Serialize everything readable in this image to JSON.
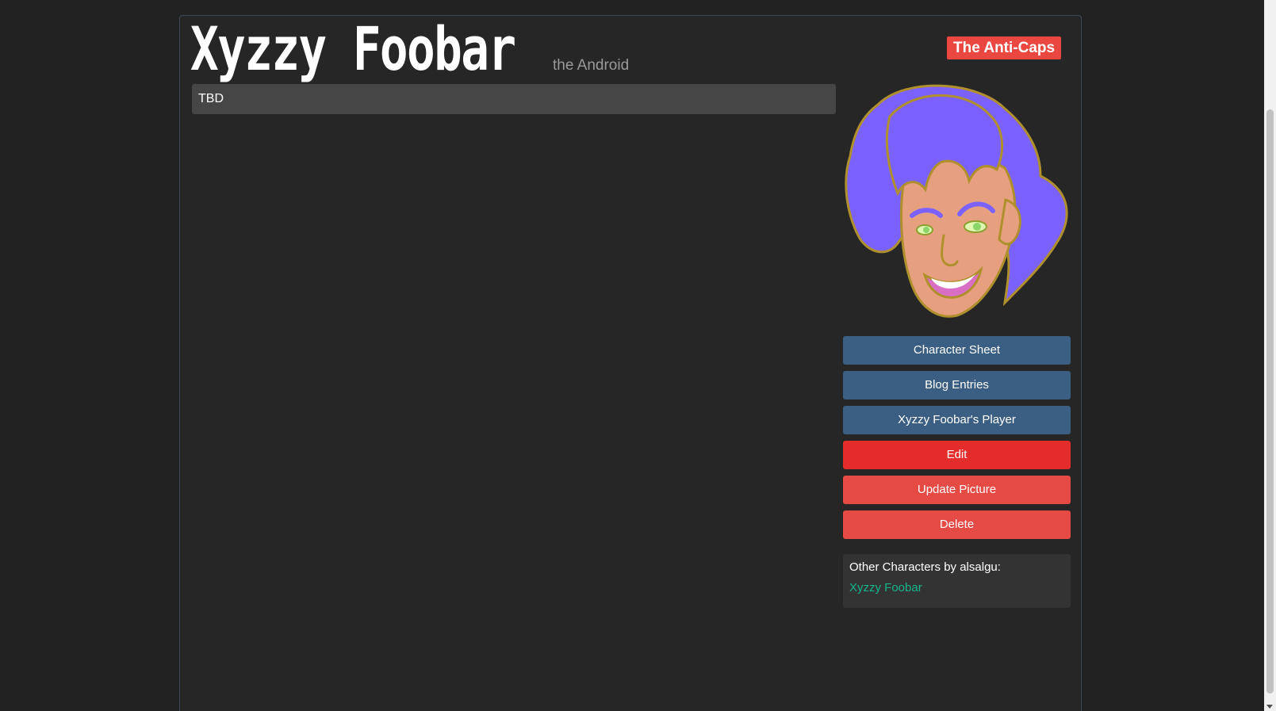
{
  "character": {
    "name": "Xyzzy Foobar",
    "subtitle": "the Android",
    "team": "The Anti-Caps",
    "description": "TBD"
  },
  "portrait": {
    "icon": "character-portrait",
    "hair_color": "#7b61ff",
    "skin_color": "#e7a07f",
    "outline_color": "#b08f2d"
  },
  "actions": {
    "character_sheet": "Character Sheet",
    "blog_entries": "Blog Entries",
    "player": "Xyzzy Foobar's Player",
    "edit": "Edit",
    "update_picture": "Update Picture",
    "delete": "Delete"
  },
  "other_characters": {
    "label": "Other Characters by alsalgu:",
    "items": [
      "Xyzzy Foobar"
    ]
  },
  "colors": {
    "team_badge": "#e9473f",
    "action_blue": "#3a5f82",
    "action_red": "#e42c2a",
    "action_salmon": "#e54b44",
    "link_green": "#13b78c"
  }
}
